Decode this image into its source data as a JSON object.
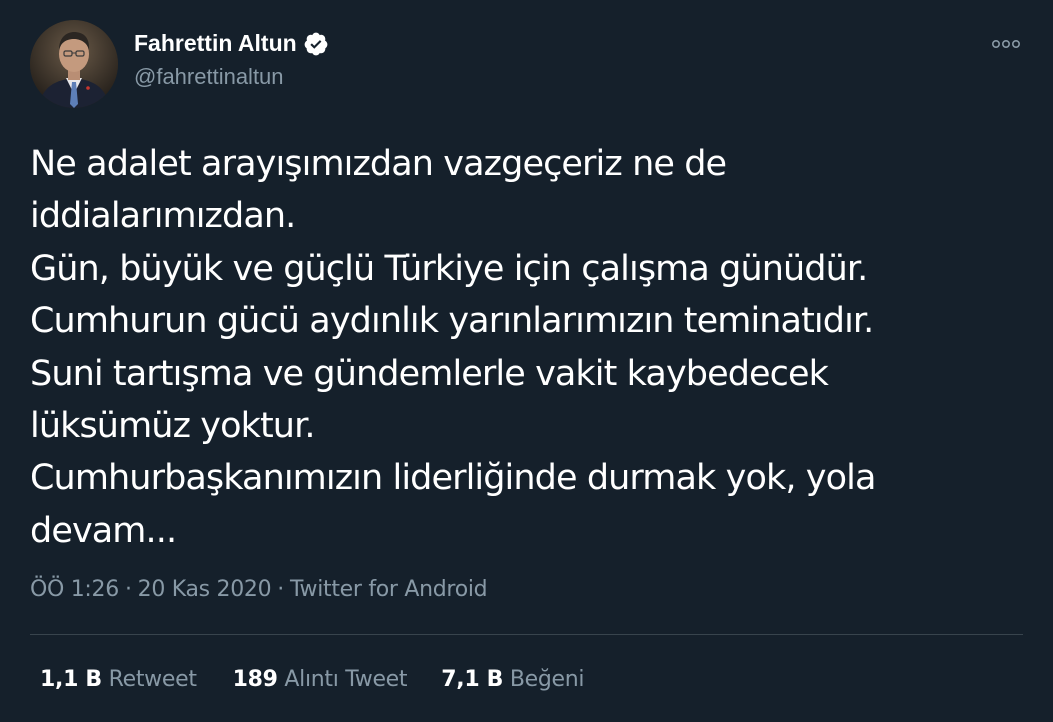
{
  "user": {
    "display_name": "Fahrettin Altun",
    "handle": "@fahrettinaltun",
    "verified": true,
    "avatar_icon": "profile-photo-avatar"
  },
  "tweet": {
    "lines": [
      "Ne adalet arayışımızdan vazgeçeriz ne de",
      "iddialarımızdan.",
      "Gün, büyük ve güçlü Türkiye için çalışma günüdür.",
      "Cumhurun gücü aydınlık yarınlarımızın teminatıdır.",
      "Suni tartışma ve gündemlerle vakit kaybedecek",
      "lüksümüz yoktur.",
      "Cumhurbaşkanımızın liderliğinde durmak yok, yola",
      "devam..."
    ]
  },
  "meta": {
    "time": "ÖÖ 1:26",
    "separator": "·",
    "date": "20 Kas 2020",
    "source": "Twitter for Android"
  },
  "stats": {
    "retweets_count": "1,1 B",
    "retweets_label": "Retweet",
    "quotes_count": "189",
    "quotes_label": "Alıntı Tweet",
    "likes_count": "7,1 B",
    "likes_label": "Beğeni"
  },
  "colors": {
    "background": "#15202b",
    "primary_text": "#ffffff",
    "secondary_text": "#8899a6",
    "divider": "#38444d"
  },
  "icons": {
    "verified": "verified-badge-icon",
    "more": "more-options-icon"
  }
}
